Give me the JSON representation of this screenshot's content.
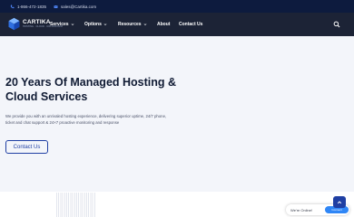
{
  "topbar": {
    "phone": "1-866-472-1835",
    "email": "sales@Cartika.com"
  },
  "logo": {
    "name": "CARTIKA",
    "tagline": "HOSTING · CLOUD · COLOCATION"
  },
  "nav": {
    "items": [
      {
        "label": "Services",
        "has_dropdown": true
      },
      {
        "label": "Options",
        "has_dropdown": true
      },
      {
        "label": "Resources",
        "has_dropdown": true
      },
      {
        "label": "About",
        "has_dropdown": false
      },
      {
        "label": "Contact Us",
        "has_dropdown": false
      }
    ],
    "search_icon": "search-icon"
  },
  "hero": {
    "title": "20 Years Of Managed Hosting & Cloud Services",
    "description": "We provide you with an unrivaled hosting experience, delivering superior uptime, 24/7 phone, ticket and chat support & 24×7 proactive monitoring and response",
    "cta_label": "Contact Us"
  },
  "chat": {
    "status": "We're Online!",
    "button_label": "Connect"
  },
  "colors": {
    "topbar_bg": "#0d1b3e",
    "navbar_bg": "#1c2336",
    "hero_bg": "#f3f5fa",
    "accent": "#1f3fa3",
    "chat_button": "#2f86f6"
  }
}
